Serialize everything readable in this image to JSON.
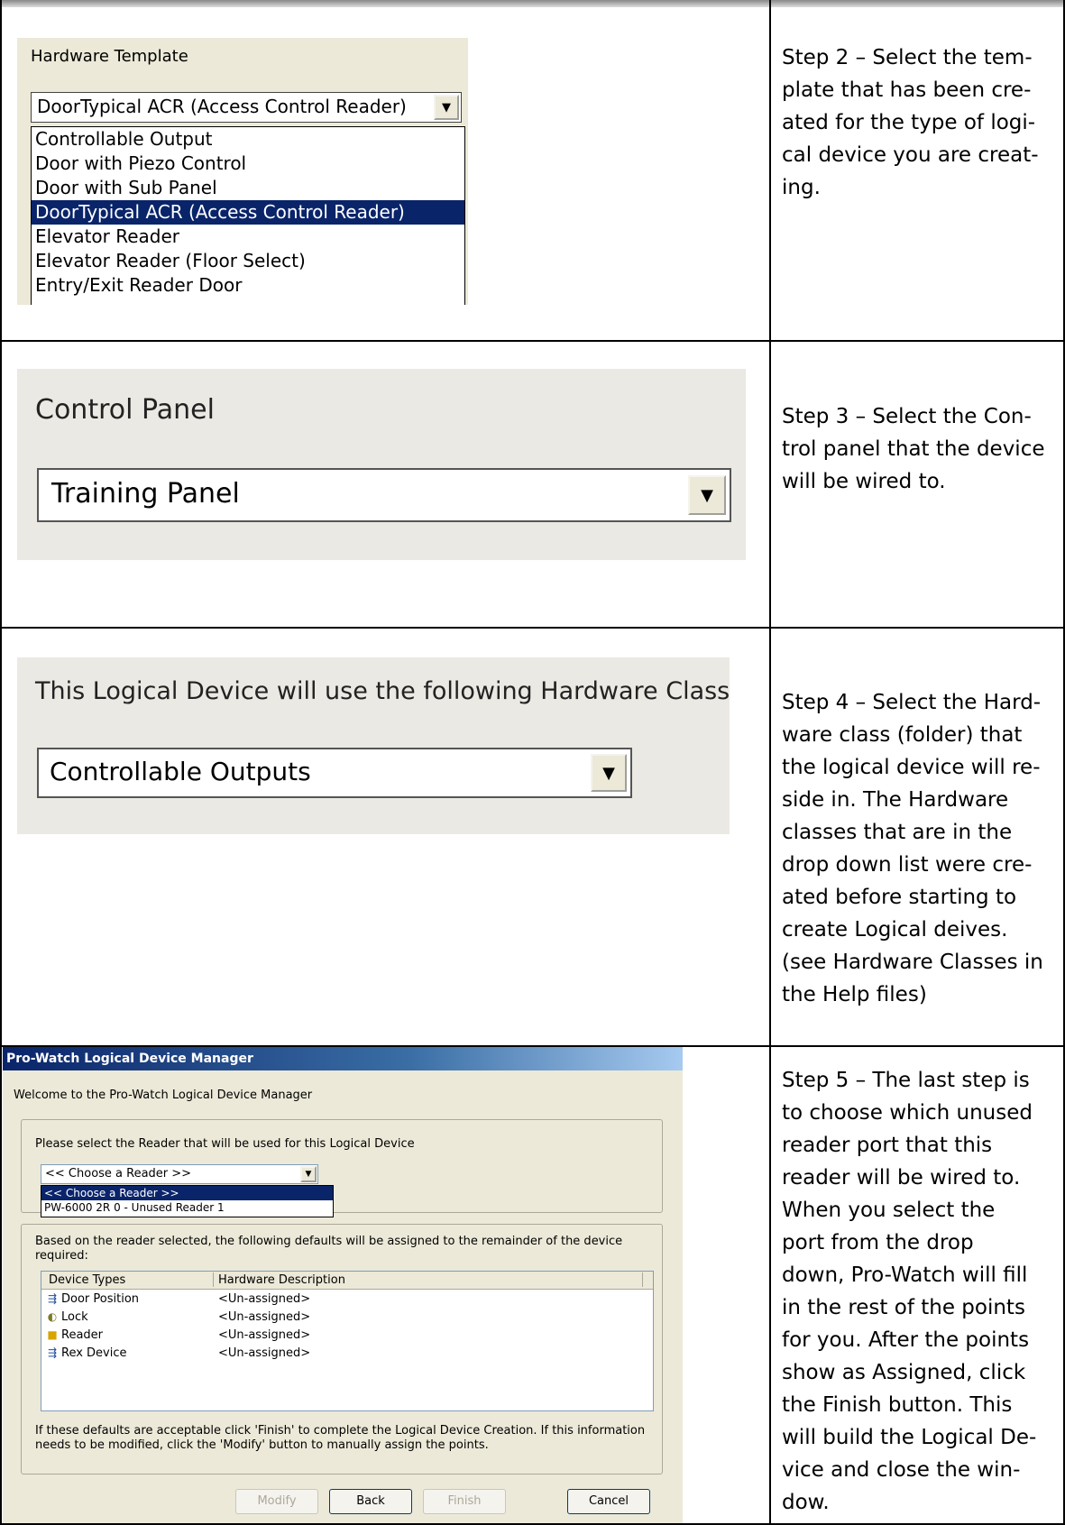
{
  "steps": [
    {
      "text": "Step 2 – Select the tem-plate that has been cre-ated for the type of logi-cal device you are creat-ing.",
      "lines": [
        "Step 2 – Select the tem-",
        "plate that has been cre-",
        "ated for the type of logi-",
        "cal device you are creat-",
        "ing."
      ]
    },
    {
      "lines": [
        "Step 3 – Select the Con-",
        "trol panel that the device",
        "will be wired to."
      ]
    },
    {
      "lines": [
        "Step 4 – Select the Hard-",
        "ware class (folder) that",
        "the logical device will re-",
        "side in. The Hardware",
        "classes that are in the",
        "drop down list were cre-",
        "ated before starting to",
        "create Logical deives.",
        "(see Hardware Classes in",
        "the Help files)"
      ]
    },
    {
      "lines": [
        "Step 5 – The last step is",
        "to choose which unused",
        "reader port that this",
        "reader will be wired to.",
        "When you select the",
        "port from the drop",
        "down, Pro-Watch will fill",
        "in the rest of the points",
        "for you. After the points",
        "show as Assigned, click",
        "the Finish button. This",
        "will build the Logical De-",
        "vice and close the win-",
        "dow."
      ]
    }
  ],
  "hardware_template": {
    "label": "Hardware Template",
    "selected": "DoorTypical ACR (Access Control Reader)",
    "options": [
      "Controllable Output",
      "Door with Piezo Control",
      "Door with Sub Panel",
      "DoorTypical ACR (Access Control Reader)",
      "Elevator Reader",
      "Elevator Reader (Floor Select)",
      "Entry/Exit Reader Door"
    ],
    "highlighted_index": 3
  },
  "control_panel": {
    "label": "Control Panel",
    "selected": "Training Panel"
  },
  "hardware_class": {
    "label": "This Logical Device will use the following Hardware Class",
    "selected": "Controllable Outputs"
  },
  "device_manager": {
    "title": "Pro-Watch Logical Device Manager",
    "welcome": "Welcome to the Pro-Watch Logical Device Manager",
    "reader_prompt": "Please select the Reader that will be used for this Logical Device",
    "reader_selected": "<< Choose a Reader >>",
    "reader_options": [
      "<< Choose a Reader >>",
      "PW-6000 2R 0 - Unused Reader 1"
    ],
    "defaults_text": "Based on the reader selected, the following defaults will be assigned to the remainder of the device required:",
    "columns": [
      "Device Types",
      "Hardware Description"
    ],
    "rows": [
      {
        "type": "Door Position",
        "hw": "<Un-assigned>",
        "icon": "door-position-icon"
      },
      {
        "type": "Lock",
        "hw": "<Un-assigned>",
        "icon": "lock-icon"
      },
      {
        "type": "Reader",
        "hw": "<Un-assigned>",
        "icon": "reader-icon"
      },
      {
        "type": "Rex Device",
        "hw": "<Un-assigned>",
        "icon": "rex-device-icon"
      }
    ],
    "footer": "If these defaults are acceptable click 'Finish' to complete the Logical Device Creation. If this information needs to be modified, click the 'Modify' button to manually assign the points.",
    "buttons": {
      "modify": "Modify",
      "back": "Back",
      "finish": "Finish",
      "cancel": "Cancel"
    }
  }
}
